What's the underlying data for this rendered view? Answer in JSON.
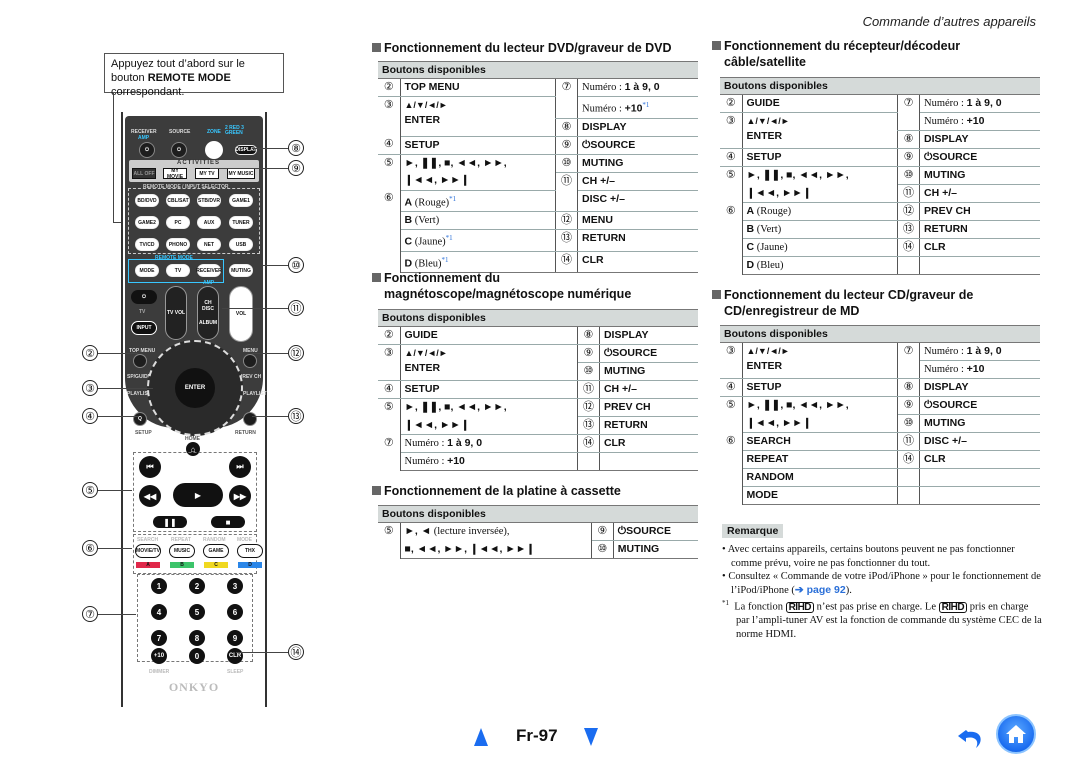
{
  "header": {
    "section": "Commande d’autres appareils"
  },
  "callout": {
    "text_before": "Appuyez tout d’abord sur le bouton ",
    "bold": "REMOTE MODE",
    "text_after": " correspondant."
  },
  "remote": {
    "top_labels": {
      "receiver": "RECEIVER",
      "amp": "AMP",
      "source": "SOURCE",
      "zone": "ZONE",
      "zone_sub": "2 RED 3 GREEN",
      "display": "DISPLAY"
    },
    "activities_label": "ACTIVITIES",
    "activities": [
      "ALL OFF",
      "MY MOVIE",
      "MY TV",
      "MY MUSIC"
    ],
    "selector_label": "REMOTE MODE / INPUT SELECTOR",
    "selectors": [
      "BD/DVD",
      "CBL/SAT",
      "STB/DVR",
      "GAME1",
      "GAME2",
      "PC",
      "AUX",
      "TUNER",
      "TV/CD",
      "PHONO",
      "NET",
      "USB"
    ],
    "remote_mode_label": "REMOTE MODE",
    "mode_buttons": [
      "MODE",
      "TV",
      "RECEIVER",
      "MUTING"
    ],
    "amp_label": "AMP",
    "tv_label": "TV",
    "input": "INPUT",
    "tv_vol": "TV VOL",
    "ch_disc": "CH DISC",
    "album": "ALBUM",
    "vol": "VOL",
    "top_menu": "TOP MENU",
    "menu": "MENU",
    "sp_guide": "SP/GUIDE",
    "prev_ch": "PREV CH",
    "playlist_l": "PLAYLIST",
    "playlist_r": "PLAYLIST",
    "enter": "ENTER",
    "setup": "SETUP",
    "q": "Q",
    "return": "RETURN",
    "home": "HOME",
    "color_labels": [
      "SEARCH",
      "REPEAT",
      "RANDOM",
      "MODE"
    ],
    "color_buttons": [
      "MOVIE/TV",
      "MUSIC",
      "GAME",
      "THX"
    ],
    "color_keys": [
      {
        "label": "A",
        "color": "#e0284a"
      },
      {
        "label": "B",
        "color": "#3cc46a"
      },
      {
        "label": "C",
        "color": "#f0d820"
      },
      {
        "label": "D",
        "color": "#2a86e8"
      }
    ],
    "numbers": [
      "1",
      "2",
      "3",
      "4",
      "5",
      "6",
      "7",
      "8",
      "9",
      "+10",
      "0",
      "CLR"
    ],
    "dimmer": "DIMMER",
    "sleep": "SLEEP",
    "brand": "ONKYO",
    "callouts": [
      "②",
      "③",
      "④",
      "⑤",
      "⑥",
      "⑦",
      "⑧",
      "⑨",
      "⑩",
      "⑪",
      "⑫",
      "⑬",
      "⑭"
    ]
  },
  "common": {
    "available_buttons": "Boutons disponibles",
    "numero": "Numéro : ",
    "a": " à ",
    "footnote_mark": "*1"
  },
  "dvd": {
    "title": "Fonctionnement du lecteur DVD/graveur de DVD",
    "rows": [
      {
        "ln": "②",
        "l": "TOP MENU",
        "rn": "⑦",
        "r": "1 à 9, 0"
      },
      {
        "ln": "③",
        "l": "▲/▼/◄/►",
        "l2": "ENTER",
        "r": "+10"
      },
      {
        "rn": "⑧",
        "r": "DISPLAY"
      },
      {
        "ln": "④",
        "l": "SETUP",
        "rn": "⑨",
        "r": "⏻SOURCE"
      },
      {
        "ln": "⑤",
        "l": "►, ❚❚, ■, ◄◄, ►►,",
        "rn": "⑩",
        "r": "MUTING"
      },
      {
        "l": "❙◄◄, ►►❙",
        "rn": "⑪",
        "r": "CH +/–"
      },
      {
        "ln": "⑥",
        "l": "A",
        "lp": "(Rouge)",
        "r": "DISC +/–"
      },
      {
        "l": "B",
        "lp": "(Vert)",
        "rn": "⑫",
        "r": "MENU"
      },
      {
        "l": "C",
        "lp": "(Jaune)",
        "rn": "⑬",
        "r": "RETURN"
      },
      {
        "l": "D",
        "lp": "(Bleu)",
        "rn": "⑭",
        "r": "CLR"
      }
    ]
  },
  "vcr": {
    "title_line1": "Fonctionnement du",
    "title_line2": "magnétoscope/magnétoscope numérique",
    "rows": [
      {
        "ln": "②",
        "l": "GUIDE",
        "rn": "⑧",
        "r": "DISPLAY"
      },
      {
        "ln": "③",
        "l": "▲/▼/◄/►",
        "l2": "ENTER",
        "rn": "⑨",
        "r": "⏻SOURCE"
      },
      {
        "rn": "⑩",
        "r": "MUTING"
      },
      {
        "ln": "④",
        "l": "SETUP",
        "rn": "⑪",
        "r": "CH +/–"
      },
      {
        "ln": "⑤",
        "l": "►, ❚❚, ■, ◄◄, ►►,",
        "rn": "⑫",
        "r": "PREV CH"
      },
      {
        "l": "❙◄◄, ►►❙",
        "rn": "⑬",
        "r": "RETURN"
      },
      {
        "ln": "⑦",
        "l": "1 à 9, 0",
        "rn": "⑭",
        "r": "CLR"
      },
      {
        "l": "+10"
      }
    ]
  },
  "cassette": {
    "title": "Fonctionnement de la platine à cassette",
    "rows": [
      {
        "ln": "⑤",
        "l": "►, ◄",
        "lp": "(lecture inversée),",
        "rn": "⑨",
        "r": "⏻SOURCE"
      },
      {
        "l": "■, ◄◄, ►►, ❙◄◄, ►►❙",
        "rn": "⑩",
        "r": "MUTING"
      }
    ]
  },
  "cable": {
    "title_line1": "Fonctionnement du récepteur/décodeur",
    "title_line2": "câble/satellite",
    "rows": [
      {
        "ln": "②",
        "l": "GUIDE",
        "rn": "⑦",
        "r": "1 à 9, 0"
      },
      {
        "ln": "③",
        "l": "▲/▼/◄/►",
        "l2": "ENTER",
        "r": "+10"
      },
      {
        "rn": "⑧",
        "r": "DISPLAY"
      },
      {
        "ln": "④",
        "l": "SETUP",
        "rn": "⑨",
        "r": "⏻SOURCE"
      },
      {
        "ln": "⑤",
        "l": "►, ❚❚, ■, ◄◄, ►►,",
        "rn": "⑩",
        "r": "MUTING"
      },
      {
        "l": "❙◄◄, ►►❙",
        "rn": "⑪",
        "r": "CH +/–"
      },
      {
        "ln": "⑥",
        "l": "A",
        "lp": "(Rouge)",
        "rn": "⑫",
        "r": "PREV CH"
      },
      {
        "l": "B",
        "lp": "(Vert)",
        "rn": "⑬",
        "r": "RETURN"
      },
      {
        "l": "C",
        "lp": "(Jaune)",
        "rn": "⑭",
        "r": "CLR"
      },
      {
        "l": "D",
        "lp": "(Bleu)"
      }
    ]
  },
  "cd": {
    "title_line1": "Fonctionnement du lecteur CD/graveur de",
    "title_line2": "CD/enregistreur de MD",
    "rows": [
      {
        "ln": "③",
        "l": "▲/▼/◄/►",
        "l2": "ENTER",
        "rn": "⑦",
        "r": "1 à 9, 0"
      },
      {
        "r": "+10"
      },
      {
        "ln": "④",
        "l": "SETUP",
        "rn": "⑧",
        "r": "DISPLAY"
      },
      {
        "ln": "⑤",
        "l": "►, ❚❚, ■, ◄◄, ►►,",
        "rn": "⑨",
        "r": "⏻SOURCE"
      },
      {
        "l": "❙◄◄, ►►❙",
        "rn": "⑩",
        "r": "MUTING"
      },
      {
        "ln": "⑥",
        "l": "SEARCH",
        "rn": "⑪",
        "r": "DISC +/–"
      },
      {
        "l": "REPEAT",
        "rn": "⑭",
        "r": "CLR"
      },
      {
        "l": "RANDOM"
      },
      {
        "l": "MODE"
      }
    ]
  },
  "remarque": {
    "label": "Remarque",
    "bullet1": "Avec certains appareils, certains boutons peuvent ne pas fonctionner comme prévu, voire ne pas fonctionner du tout.",
    "bullet2_before": "Consultez « Commande de votre iPod/iPhone » pour le fonctionnement de l’iPod/iPhone (",
    "bullet2_link": "➔ page 92",
    "bullet2_after": ").",
    "fn_mark": "*1",
    "fn_a": "La fonction ",
    "rihd": "RIHD",
    "fn_b": " n’est pas prise en charge. Le ",
    "fn_c": " pris en charge par l’ampli-tuner AV est la fonction de commande du système CEC de la norme HDMI."
  },
  "footer": {
    "page": "Fr-97"
  }
}
